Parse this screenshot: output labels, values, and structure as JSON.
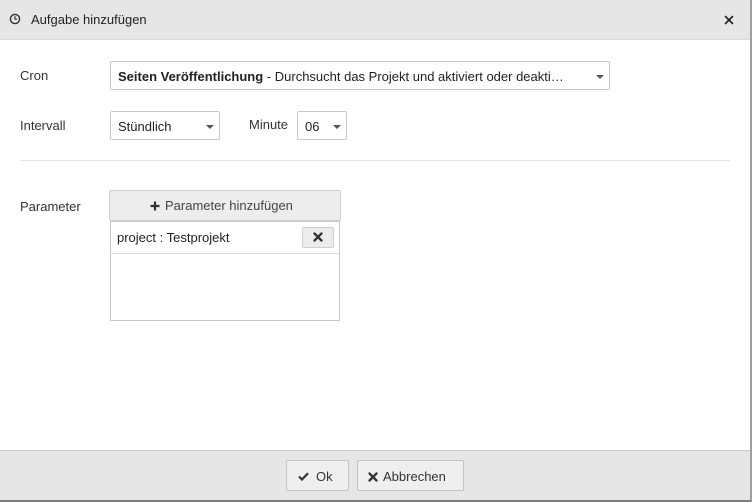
{
  "dialog": {
    "title": "Aufgabe hinzufügen",
    "title_icon": "clock-icon",
    "close_icon": "close-icon"
  },
  "form": {
    "cron": {
      "label": "Cron",
      "selected_bold": "Seiten Veröffentlichung",
      "selected_rest": " - Durchsucht das Projekt und aktiviert oder deakti…"
    },
    "interval": {
      "label": "Intervall",
      "selected": "Stündlich"
    },
    "minute": {
      "label": "Minute",
      "selected": "06"
    },
    "parameters": {
      "label": "Parameter",
      "add_button_label": "Parameter hinzufügen",
      "add_icon": "plus-icon",
      "remove_icon": "remove-x-icon",
      "items": [
        {
          "text": "project : Testprojekt"
        }
      ]
    }
  },
  "footer": {
    "ok_label": "Ok",
    "ok_icon": "check-icon",
    "cancel_label": "Abbrechen",
    "cancel_icon": "x-icon"
  },
  "colors": {
    "titlebar_bg": "#e6e6e6",
    "footer_bg": "#e6e6e6",
    "button_bg": "#efefef",
    "border": "#c8c8c8"
  }
}
